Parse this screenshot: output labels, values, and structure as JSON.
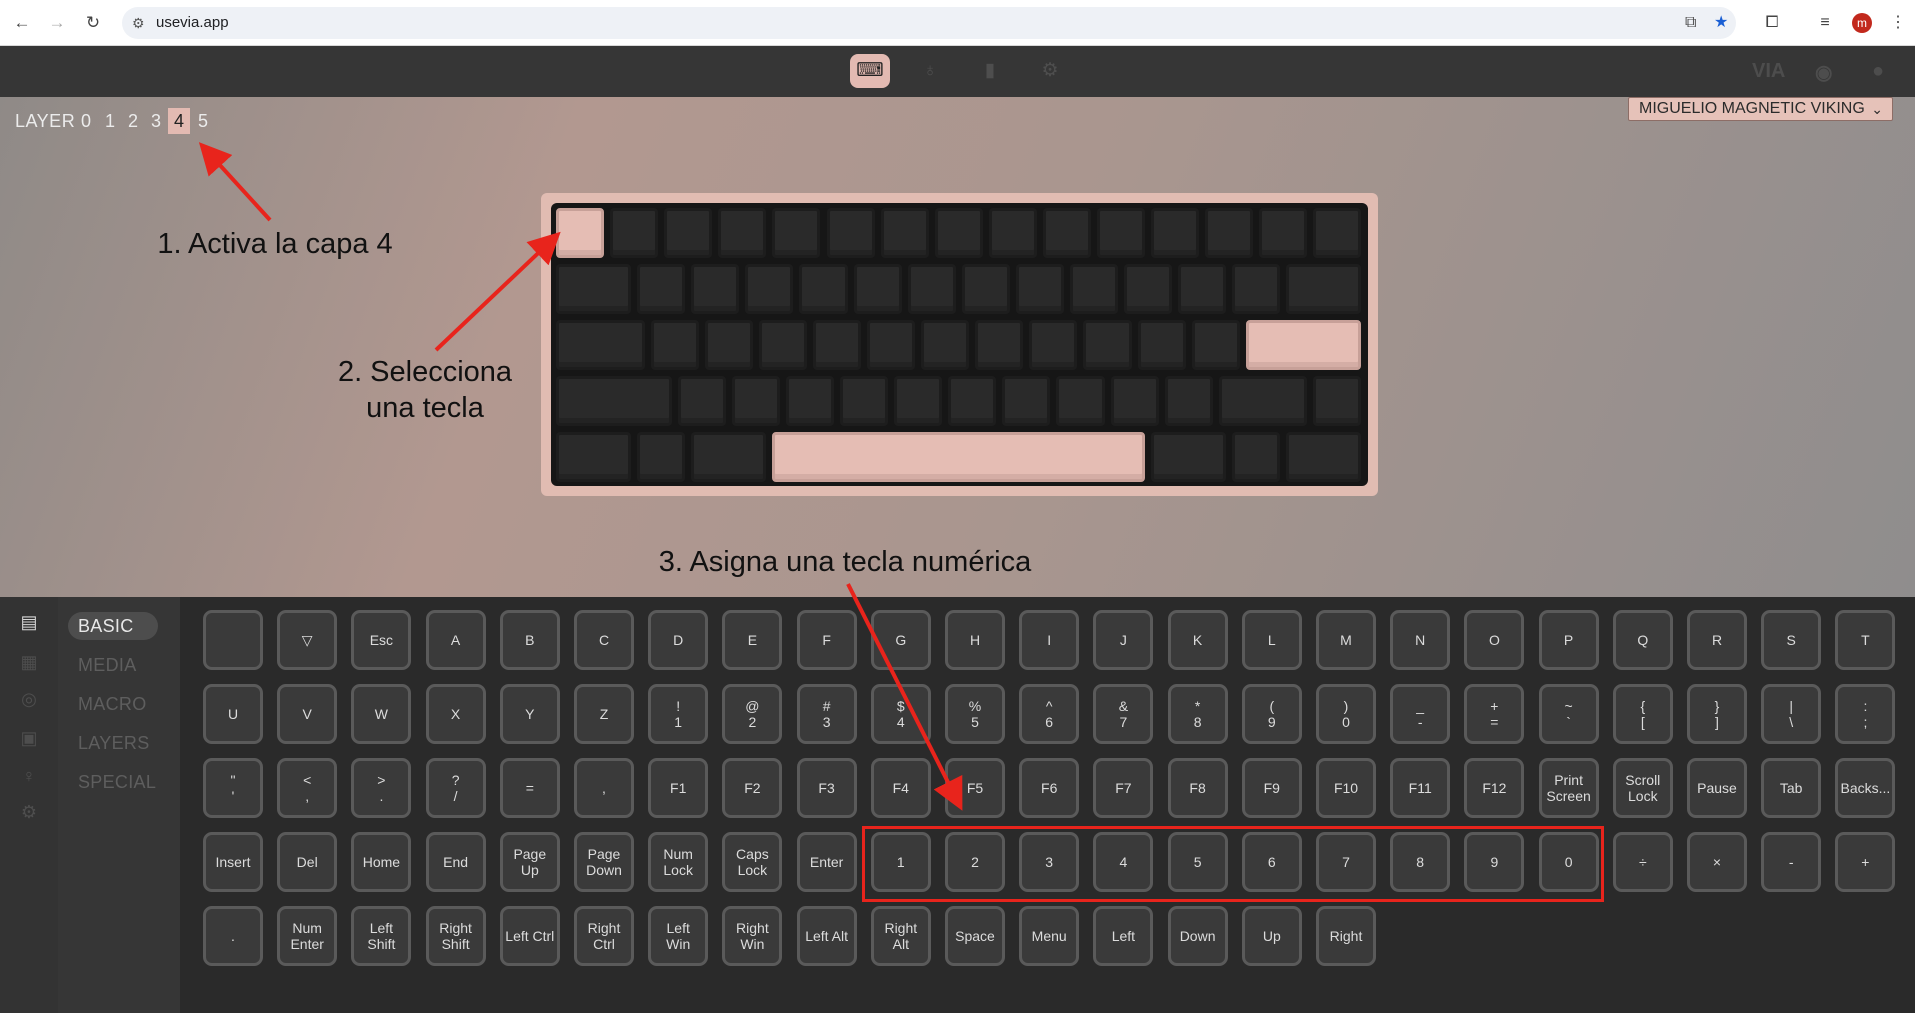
{
  "browser": {
    "url": "usevia.app",
    "back_icon": "arrow-left-icon",
    "forward_icon": "arrow-right-icon",
    "reload_icon": "reload-icon",
    "profile_initial": "m"
  },
  "topbar": {
    "tabs": [
      "keyboard-icon",
      "stethoscope-icon",
      "brush-icon",
      "gear-icon"
    ],
    "active_tab": 0,
    "brand": "VIA"
  },
  "layers": {
    "label": "LAYER",
    "numbers": [
      "0",
      "1",
      "2",
      "3",
      "4",
      "5"
    ],
    "active": 4
  },
  "keyboard_select": "MIGUELIO MAGNETIC VIKING",
  "annotations": {
    "step1": "1. Activa la capa 4",
    "step2": "2. Selecciona\nuna tecla",
    "step3": "3. Asigna una tecla numérica"
  },
  "categories": [
    "BASIC",
    "MEDIA",
    "MACRO",
    "LAYERS",
    "SPECIAL"
  ],
  "active_category": 0,
  "sidebar_icons": [
    "book-icon",
    "dashboard-icon",
    "record-icon",
    "save-icon",
    "bulb-icon",
    "chip-icon"
  ],
  "keycodes": [
    [
      "",
      "▽",
      "Esc",
      "A",
      "B",
      "C",
      "D",
      "E",
      "F",
      "G",
      "H",
      "I",
      "J",
      "K",
      "L",
      "M",
      "N",
      "O",
      "P",
      "Q",
      "R",
      "S",
      "T"
    ],
    [
      "U",
      "V",
      "W",
      "X",
      "Y",
      "Z",
      "!\n1",
      "@\n2",
      "#\n3",
      "$\n4",
      "%\n5",
      "^\n6",
      "&\n7",
      "*\n8",
      "(\n9",
      ")\n0",
      "_\n-",
      "+\n=",
      "~\n`",
      "{\n[",
      "}\n]",
      "|\n\\",
      ":\n;"
    ],
    [
      "\"\n'",
      "<\n,",
      ">\n.",
      "?\n/",
      "=",
      ",",
      "F1",
      "F2",
      "F3",
      "F4",
      "F5",
      "F6",
      "F7",
      "F8",
      "F9",
      "F10",
      "F11",
      "F12",
      "Print\nScreen",
      "Scroll\nLock",
      "Pause",
      "Tab",
      "Backs..."
    ],
    [
      "Insert",
      "Del",
      "Home",
      "End",
      "Page\nUp",
      "Page\nDown",
      "Num\nLock",
      "Caps\nLock",
      "Enter",
      "1",
      "2",
      "3",
      "4",
      "5",
      "6",
      "7",
      "8",
      "9",
      "0",
      "÷",
      "×",
      "-",
      "+"
    ],
    [
      ".",
      "Num\nEnter",
      "Left\nShift",
      "Right\nShift",
      "Left Ctrl",
      "Right\nCtrl",
      "Left\nWin",
      "Right\nWin",
      "Left Alt",
      "Right\nAlt",
      "Space",
      "Menu",
      "Left",
      "Down",
      "Up",
      "Right"
    ]
  ]
}
